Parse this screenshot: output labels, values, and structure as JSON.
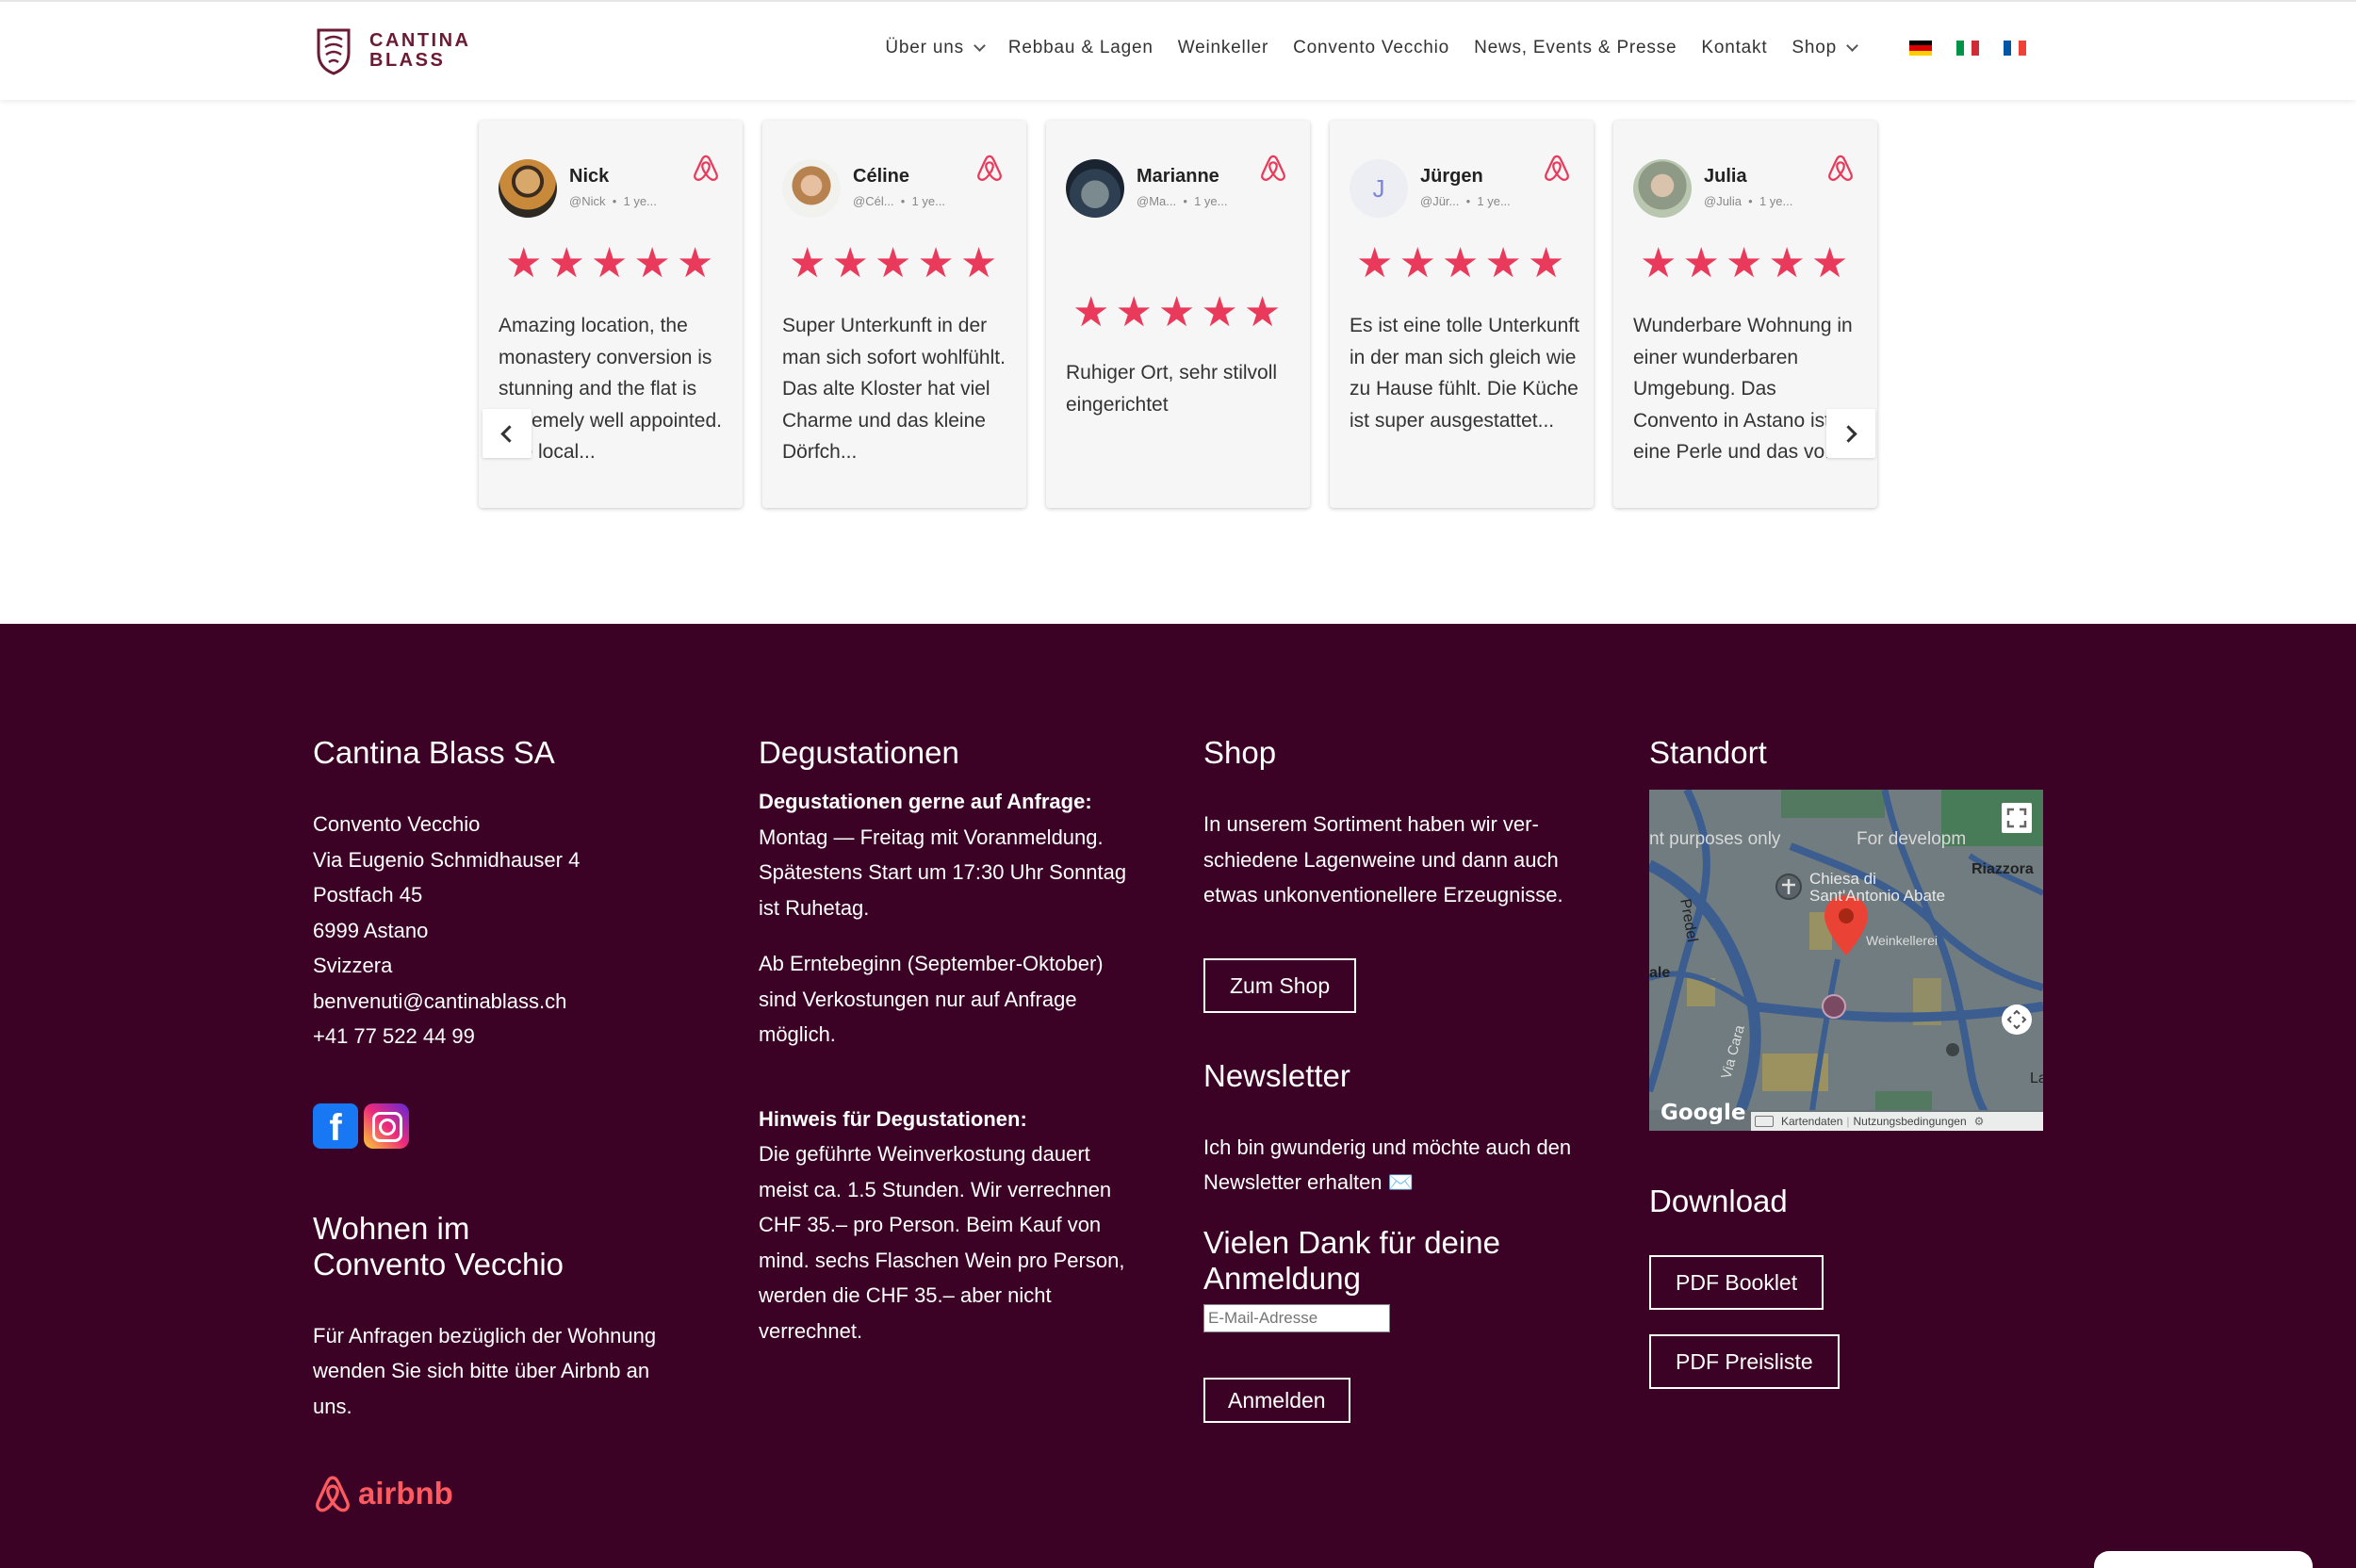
{
  "header": {
    "logo_line1": "CANTINA",
    "logo_line2": "BLASS",
    "nav": [
      {
        "label": "Über uns",
        "dropdown": true
      },
      {
        "label": "Rebbau & Lagen",
        "dropdown": false
      },
      {
        "label": "Weinkeller",
        "dropdown": false
      },
      {
        "label": "Convento Vecchio",
        "dropdown": false
      },
      {
        "label": "News, Events & Presse",
        "dropdown": false
      },
      {
        "label": "Kontakt",
        "dropdown": false
      },
      {
        "label": "Shop",
        "dropdown": true
      }
    ],
    "flags": [
      "de",
      "it",
      "fr"
    ]
  },
  "reviews": [
    {
      "name": "Nick",
      "handle": "@Nick",
      "age": "1 ye...",
      "rating": 5,
      "text": "Amazing location, the monastery conversion is stunning and the flat is extremely well appointed. The local..."
    },
    {
      "name": "Céline",
      "handle": "@Cél...",
      "age": "1 ye...",
      "rating": 5,
      "text": "Super Unterkunft in der man sich sofort wohlfühlt. Das alte Kloster hat viel Charme und das kleine Dörfch..."
    },
    {
      "name": "Marianne",
      "handle": "@Ma...",
      "age": "1 ye...",
      "rating": 5,
      "text": "Ruhiger Ort, sehr stilvoll eingerichtet"
    },
    {
      "name": "Jürgen",
      "handle": "@Jür...",
      "age": "1 ye...",
      "rating": 5,
      "initial": "J",
      "text": "Es ist eine tolle Unterkunft in der man sich gleich wie zu Hause fühlt. Die Küche ist super ausgestattet..."
    },
    {
      "name": "Julia",
      "handle": "@Julia",
      "age": "1 ye...",
      "rating": 5,
      "text": "Wunderbare Wohnung in einer wunderbaren Umgebung. Das Convento in Astano ist eine Perle und das vo..."
    }
  ],
  "footer": {
    "company": {
      "title": "Cantina Blass SA",
      "lines": [
        "Convento Vecchio",
        "Via Eugenio Schmidhauser 4",
        "Postfach 45",
        "6999 Astano",
        "Svizzera",
        "benvenuti@cantinablass.ch",
        "+41 77 522 44 99"
      ]
    },
    "wohnen": {
      "title_line1": "Wohnen im",
      "title_line2": "Convento Vecchio",
      "text": "Für Anfragen bezüglich der Wohnung wenden Sie sich bitte über Airbnb an uns.",
      "airbnb_label": "airbnb"
    },
    "degustationen": {
      "title": "Degustationen",
      "bold1": "Degustationen gerne auf Anfrage:",
      "text1": "Montag — Freitag mit Voranmeldung. Spätestens Start um 17:30 Uhr Sonntag ist Ruhetag.",
      "text2": "Ab Erntebeginn (September-Oktober) sind Verkostungen nur auf Anfrage möglich.",
      "bold2": "Hinweis für Degustationen:",
      "text3": "Die geführte Weinverkostung dauert meist ca. 1.5 Stunden. Wir verrech­nen CHF 35.– pro Person. Beim Kauf von mind. sechs Flaschen Wein pro Person, werden die CHF 35.– aber nicht verrechnet."
    },
    "shop": {
      "title": "Shop",
      "text": "In unserem Sortiment haben wir ver­schiedene Lagenweine und dann auch etwas unkonventionellere Erzeugnisse.",
      "button": "Zum Shop"
    },
    "newsletter": {
      "title": "Newsletter",
      "text": "Ich bin gwunderig und möchte auch den Newsletter erhalten ✉️",
      "thanks_line1": "Vielen Dank für deine",
      "thanks_line2": "Anmeldung",
      "email_placeholder": "E-Mail-Adresse",
      "button": "Anmelden"
    },
    "standort": {
      "title": "Standort",
      "map": {
        "watermark_left": "nt purposes only",
        "watermark_right": "For developm",
        "place_label_1": "Chiesa di",
        "place_label_2": "Sant'Antonio Abate",
        "poi_label": "Weinkellerei",
        "road_predel": "Predel",
        "road_riazzora": "Riazzora",
        "road_via_cara": "Via Cara",
        "road_ale": "ale",
        "road_la": "La",
        "google": "Google",
        "attr_data": "Kartendaten",
        "attr_terms": "Nutzungsbedingungen"
      }
    },
    "download": {
      "title": "Download",
      "buttons": [
        "PDF Booklet",
        "PDF Preisliste"
      ]
    }
  }
}
